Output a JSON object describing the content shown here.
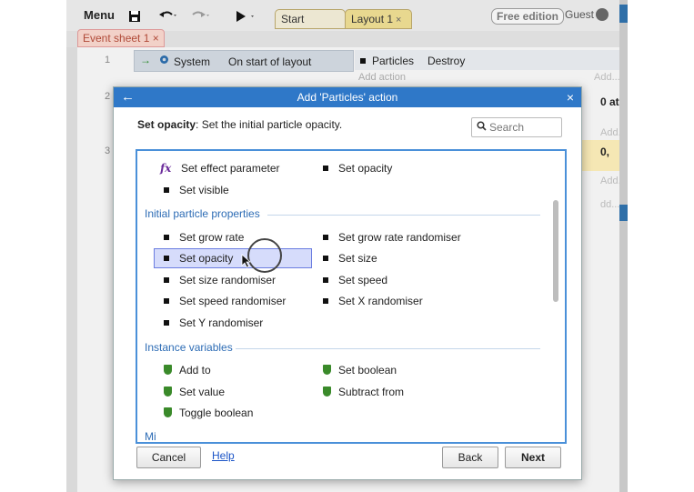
{
  "toolbar": {
    "menu_label": "Menu",
    "tabs": [
      {
        "label": "Start page",
        "close": "×"
      },
      {
        "label": "Layout 1",
        "close": "×"
      }
    ],
    "edition_badge": "Free edition",
    "user_label": "Guest"
  },
  "sheet_tab": {
    "label": "Event sheet 1",
    "close": "×"
  },
  "event_sheet": {
    "rows": [
      {
        "number": "1",
        "condition_object": "System",
        "condition_text": "On start of layout",
        "action_object": "Particles",
        "action_text": "Destroy",
        "add_action": "Add action",
        "add_faded": "Add..."
      },
      {
        "number": "2",
        "right_text": "0 at",
        "add_faded": "Add..."
      },
      {
        "number": "3",
        "right_text": "0,",
        "add_faded": "Add..."
      }
    ],
    "faded_add_4": "dd..."
  },
  "dialog": {
    "title": "Add 'Particles' action",
    "back_icon": "←",
    "close_icon": "×",
    "description_bold": "Set opacity",
    "description_rest": ": Set the initial particle opacity.",
    "search_placeholder": "Search",
    "items_top": [
      {
        "label": "Set effect parameter",
        "icon": "fx"
      },
      {
        "label": "Set opacity",
        "icon": "square"
      },
      {
        "label": "Set visible",
        "icon": "square"
      }
    ],
    "section_initial": "Initial particle properties",
    "items_initial": [
      {
        "label": "Set grow rate"
      },
      {
        "label": "Set grow rate randomiser"
      },
      {
        "label": "Set opacity",
        "selected": true
      },
      {
        "label": "Set size"
      },
      {
        "label": "Set size randomiser"
      },
      {
        "label": "Set speed"
      },
      {
        "label": "Set speed randomiser"
      },
      {
        "label": "Set X randomiser"
      },
      {
        "label": "Set Y randomiser"
      }
    ],
    "section_instance": "Instance variables",
    "items_instance": [
      {
        "label": "Add to"
      },
      {
        "label": "Set boolean"
      },
      {
        "label": "Set value"
      },
      {
        "label": "Subtract from"
      },
      {
        "label": "Toggle boolean"
      }
    ],
    "section_misc_partial": "Mi",
    "buttons": {
      "cancel": "Cancel",
      "help": "Help",
      "back": "Back",
      "next": "Next"
    }
  },
  "colors": {
    "dialog_title_bg": "#2f78c8",
    "section_text": "#2d6cb5",
    "selection_bg": "#d6dcfb",
    "list_border": "#4a90d9",
    "instance_var_icon": "#3a8a2a"
  }
}
